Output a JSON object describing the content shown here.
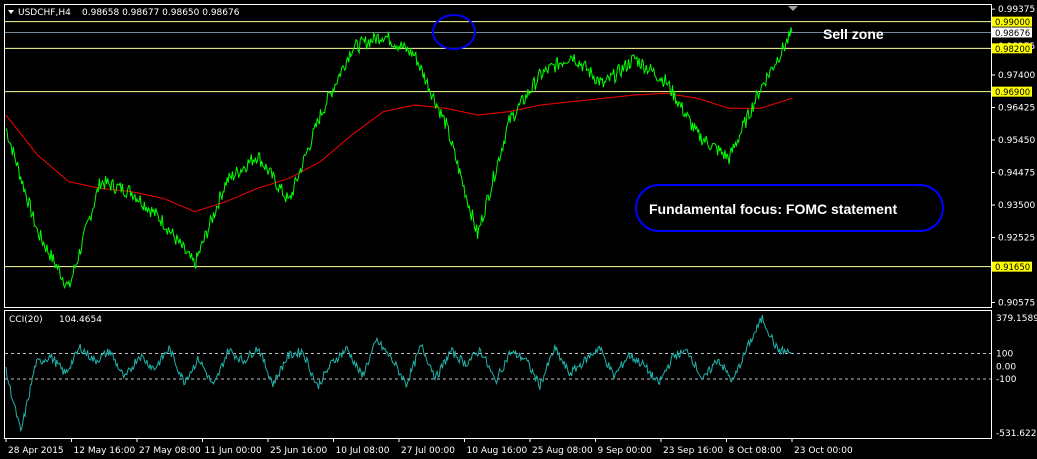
{
  "header": {
    "symbol_timeframe": "USDCHF,H4",
    "ohlc": "0.98658 0.98677 0.98650 0.98676"
  },
  "indicator": {
    "name": "CCI(20)",
    "value": "104.4654",
    "scale_top": "379.1589",
    "scale_bottom": "-531.6224",
    "level_labels": [
      "100",
      "0.00",
      "-100"
    ]
  },
  "annotations": {
    "sell_zone": "Sell zone",
    "fundamental_focus": "Fundamental focus: FOMC statement"
  },
  "colors": {
    "background": "#000000",
    "price_line": "#00ff00",
    "moving_average": "#ff0000",
    "horizontal_levels": "#ffff99",
    "level_tag": "#ffff00",
    "cci_line": "#20b2aa",
    "frame": "#ffffff",
    "annotation_outline": "#0000ff"
  },
  "chart_data": [
    {
      "type": "line",
      "title": "USDCHF,H4",
      "x": [
        "28 Apr 2015",
        "12 May 16:00",
        "27 May 08:00",
        "11 Jun 00:00",
        "25 Jun 16:00",
        "10 Jul 08:00",
        "27 Jul 00:00",
        "10 Aug 16:00",
        "25 Aug 08:00",
        "9 Sep 00:00",
        "23 Sep 16:00",
        "8 Oct 08:00",
        "23 Oct 00:00"
      ],
      "series": [
        {
          "values": [
            0.958,
            0.927,
            0.91,
            0.942,
            0.939,
            0.93,
            0.917,
            0.942,
            0.95,
            0.936,
            0.962,
            0.982,
            0.986,
            0.98,
            0.959,
            0.926,
            0.96,
            0.974,
            0.98,
            0.971,
            0.979,
            0.972,
            0.956,
            0.949,
            0.97,
            0.9867
          ]
        },
        {
          "values": [
            0.962,
            0.95,
            0.942,
            0.94,
            0.939,
            0.937,
            0.933,
            0.936,
            0.94,
            0.943,
            0.948,
            0.956,
            0.963,
            0.965,
            0.964,
            0.962,
            0.963,
            0.965,
            0.966,
            0.967,
            0.968,
            0.9685,
            0.967,
            0.964,
            0.964,
            0.967
          ]
        }
      ],
      "horizontal_levels": [
        0.99,
        0.982,
        0.969,
        0.9165
      ],
      "level_labels": [
        "0.99000",
        "0.98200",
        "0.96900",
        "0.91650"
      ],
      "current_price_label": "0.98676",
      "y_ticks": [
        "0.99375",
        "0.98275",
        "0.97400",
        "0.96425",
        "0.95450",
        "0.94475",
        "0.93500",
        "0.92525",
        "0.90575"
      ],
      "ylim": [
        0.9044,
        0.995
      ]
    },
    {
      "type": "line",
      "title": "CCI(20) 104.4654",
      "levels": [
        100,
        0,
        -100
      ],
      "ylim": [
        -531.6224,
        379.1589
      ],
      "series": [
        {
          "values": [
            -40,
            -520,
            20,
            80,
            -60,
            150,
            40,
            120,
            -100,
            90,
            -20,
            140,
            -120,
            60,
            -160,
            130,
            40,
            150,
            -140,
            80,
            120,
            -160,
            30,
            140,
            -80,
            200,
            60,
            -140,
            160,
            -90,
            120,
            20,
            130,
            -120,
            110,
            60,
            -150,
            140,
            -60,
            40,
            150,
            -80,
            90,
            10,
            -140,
            80,
            120,
            -110,
            60,
            -120,
            150,
            379,
            130,
            104
          ]
        }
      ]
    }
  ]
}
